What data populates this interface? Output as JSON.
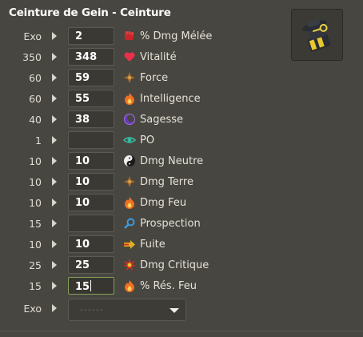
{
  "title": "Ceinture de Gein - Ceinture",
  "item_icon": "belt-item-icon",
  "rows": [
    {
      "base": "Exo",
      "value": "2",
      "label": "% Dmg Mélée",
      "icon": "fist-icon",
      "color": "#c8262a"
    },
    {
      "base": "350",
      "value": "348",
      "label": "Vitalité",
      "icon": "heart-icon",
      "color": "#e8304a"
    },
    {
      "base": "60",
      "value": "59",
      "label": "Force",
      "icon": "earth-element-icon",
      "color": "#a86a2a"
    },
    {
      "base": "60",
      "value": "55",
      "label": "Intelligence",
      "icon": "fire-element-icon",
      "color": "#f07020"
    },
    {
      "base": "40",
      "value": "38",
      "label": "Sagesse",
      "icon": "wisdom-icon",
      "color": "#8a5ad8"
    },
    {
      "base": "1",
      "value": "",
      "label": "PO",
      "icon": "range-eye-icon",
      "color": "#38b8a0"
    },
    {
      "base": "10",
      "value": "10",
      "label": "Dmg Neutre",
      "icon": "neutral-element-icon",
      "color": "#dcdcdc"
    },
    {
      "base": "10",
      "value": "10",
      "label": "Dmg Terre",
      "icon": "earth-element-icon",
      "color": "#a86a2a"
    },
    {
      "base": "10",
      "value": "10",
      "label": "Dmg Feu",
      "icon": "fire-element-icon",
      "color": "#f07020"
    },
    {
      "base": "15",
      "value": "",
      "label": "Prospection",
      "icon": "prospecting-icon",
      "color": "#3a9ae0"
    },
    {
      "base": "10",
      "value": "10",
      "label": "Fuite",
      "icon": "flee-icon",
      "color": "#e0b020"
    },
    {
      "base": "25",
      "value": "25",
      "label": "Dmg Critique",
      "icon": "critical-icon",
      "color": "#d83020"
    },
    {
      "base": "15",
      "value": "15",
      "label": "% Rés. Feu",
      "icon": "fire-element-icon",
      "color": "#f07020"
    }
  ],
  "exo_row": {
    "base": "Exo",
    "select_value": "------"
  }
}
